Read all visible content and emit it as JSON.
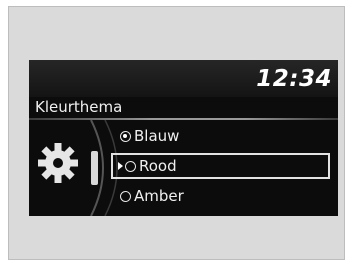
{
  "status": {
    "time": "12:34"
  },
  "menu": {
    "title": "Kleurthema",
    "options": [
      {
        "label": "Blauw",
        "selected": true
      },
      {
        "label": "Rood",
        "selected": false,
        "focused": true
      },
      {
        "label": "Amber",
        "selected": false
      }
    ]
  },
  "icons": {
    "dial": "gear-icon",
    "radio": "radio-icon",
    "pointer": "pointer-icon"
  }
}
